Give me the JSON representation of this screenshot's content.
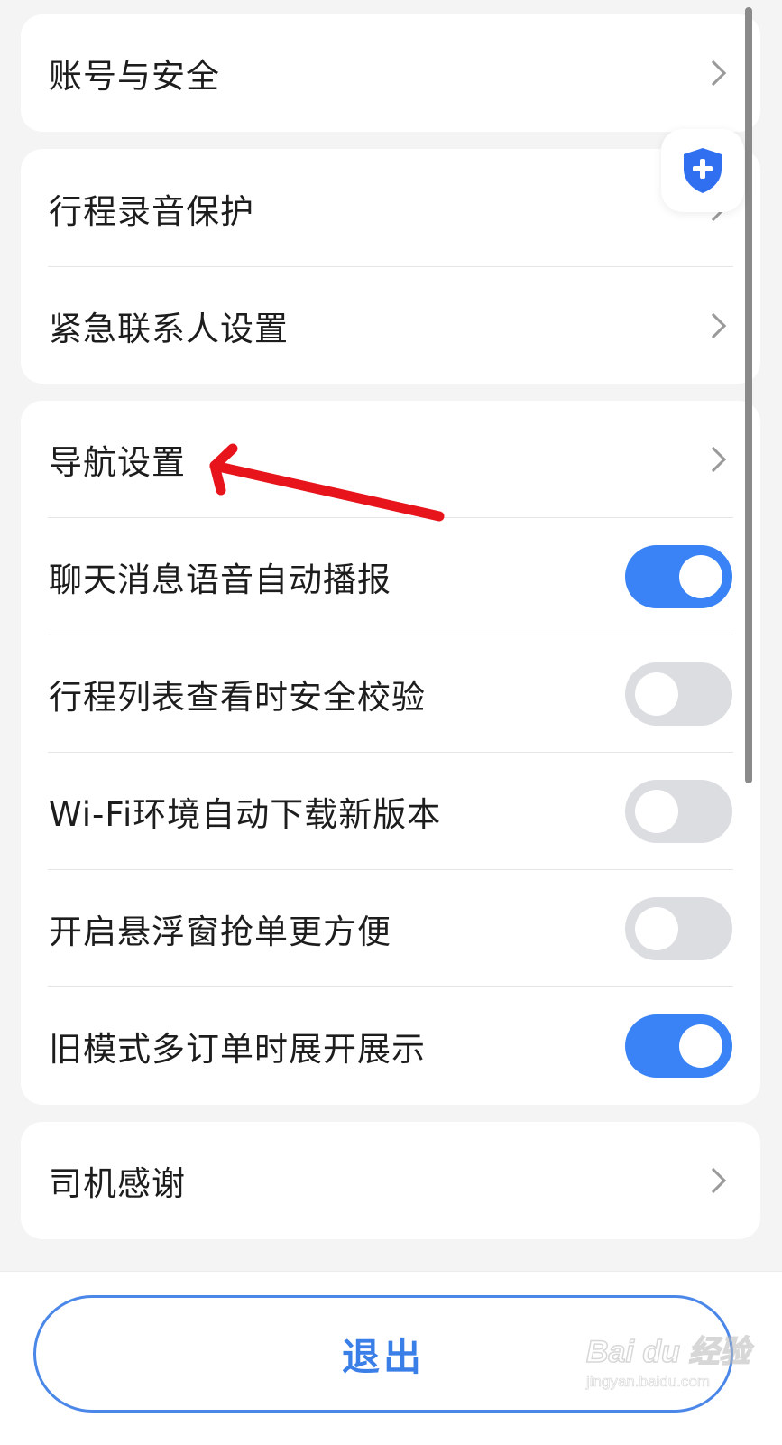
{
  "settings": {
    "account_security": "账号与安全",
    "trip_recording_protection": "行程录音保护",
    "emergency_contacts": "紧急联系人设置",
    "navigation_settings": "导航设置",
    "chat_voice_autoplay": {
      "label": "聊天消息语音自动播报",
      "enabled": true
    },
    "trip_list_security_check": {
      "label": "行程列表查看时安全校验",
      "enabled": false
    },
    "wifi_auto_download": {
      "label": "Wi-Fi环境自动下载新版本",
      "enabled": false
    },
    "floating_window": {
      "label": "开启悬浮窗抢单更方便",
      "enabled": false
    },
    "old_mode_multi_order": {
      "label": "旧模式多订单时展开展示",
      "enabled": true
    },
    "driver_thanks": "司机感谢"
  },
  "logout_label": "退出",
  "icons": {
    "row_arrow": "chevron-right-icon",
    "floating_button": "shield-plus-icon"
  },
  "colors": {
    "accent": "#3a83f6",
    "toggle_off": "#dcdde1",
    "annotation_arrow": "#e8141c",
    "background": "#f4f4f4"
  },
  "watermark": {
    "logo": "Bai du 经验",
    "url": "jingyan.baidu.com"
  }
}
